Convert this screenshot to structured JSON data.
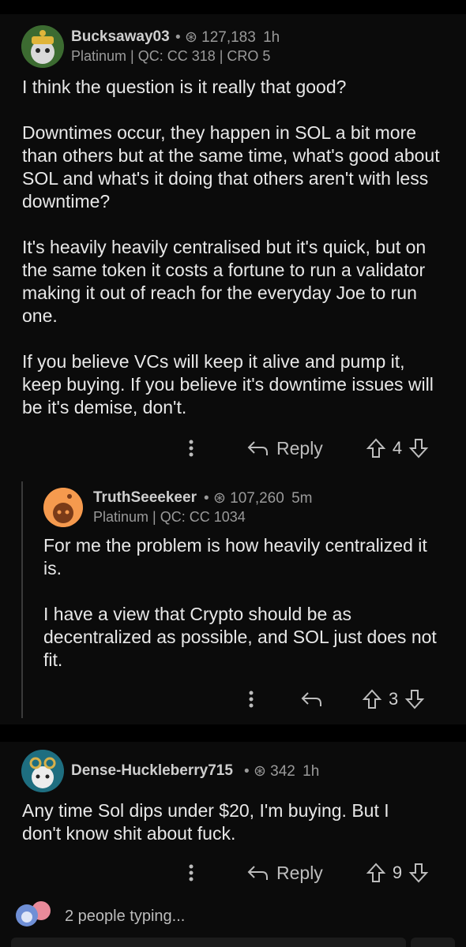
{
  "comments": [
    {
      "username": "Bucksaway03",
      "karma": "127,183",
      "age": "1h",
      "flair": "Platinum | QC: CC 318 | CRO 5",
      "paragraphs": [
        "I think the question is it really that good?",
        "Downtimes occur, they happen in SOL a bit more than others but at the same time, what's good about SOL and what's it doing that others aren't with less downtime?",
        "It's heavily heavily centralised but it's quick, but on the same token it costs a fortune to run a validator making it out of reach for the everyday Joe to run one.",
        "If you believe VCs will keep it alive and pump it, keep buying. If you believe it's downtime issues will be it's demise, don't."
      ],
      "reply_label": "Reply",
      "votes": "4"
    },
    {
      "username": "TruthSeeekeer",
      "karma": "107,260",
      "age": "5m",
      "flair": "Platinum | QC: CC 1034",
      "paragraphs": [
        "For me the problem is how heavily centralized it is.",
        "I have a view that Crypto should be as decentralized as possible, and SOL just does not fit."
      ],
      "votes": "3"
    },
    {
      "username": "Dense-Huckleberry715",
      "karma": "342",
      "age": "1h",
      "paragraphs": [
        "Any time Sol dips under $20, I'm buying. But I don't know shit about fuck."
      ],
      "reply_label": "Reply",
      "votes": "9"
    }
  ],
  "typing_indicator": "2 people typing...",
  "colors": {
    "background": "#0b0b0b",
    "separator": "#000000",
    "text": "#e8e8e8",
    "muted": "#9a9a9a"
  }
}
